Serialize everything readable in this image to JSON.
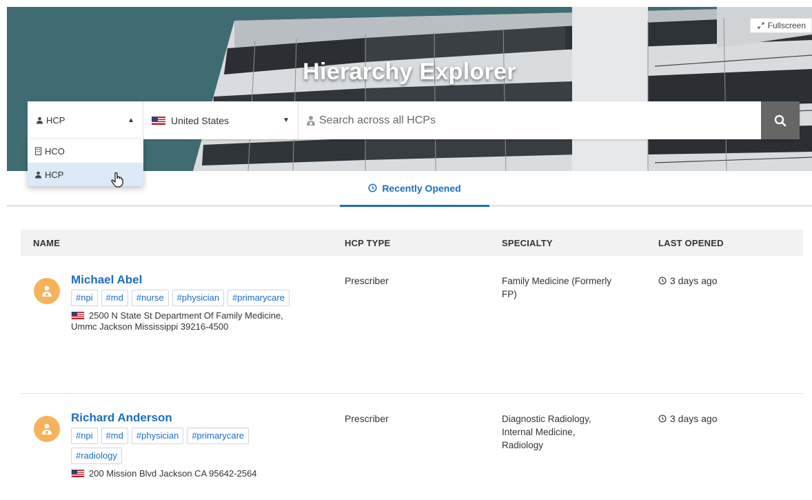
{
  "header": {
    "title": "Hierarchy Explorer",
    "fullscreen_label": "Fullscreen"
  },
  "search": {
    "type_value": "HCP",
    "country_value": "United States",
    "placeholder": "Search across all HCPs"
  },
  "type_dropdown": {
    "options": [
      {
        "label": "HCO",
        "icon": "building-icon"
      },
      {
        "label": "HCP",
        "icon": "person-icon",
        "highlighted": true
      }
    ]
  },
  "tabs": [
    {
      "label": "Recently Opened",
      "icon": "clock-icon",
      "active": true
    }
  ],
  "table": {
    "columns": [
      "NAME",
      "HCP TYPE",
      "SPECIALTY",
      "LAST OPENED"
    ],
    "rows": [
      {
        "name": "Michael Abel",
        "tags": [
          "#npi",
          "#md",
          "#nurse",
          "#physician",
          "#primarycare"
        ],
        "address": "2500 N State St Department Of Family Medicine, Ummc Jackson Mississippi 39216-4500",
        "hcp_type": "Prescriber",
        "specialty": "Family Medicine (Formerly FP)",
        "last_opened": "3 days ago"
      },
      {
        "name": "Richard Anderson",
        "tags": [
          "#npi",
          "#md",
          "#physician",
          "#primarycare",
          "#radiology"
        ],
        "address": "200 Mission Blvd Jackson CA 95642-2564",
        "hcp_type": "Prescriber",
        "specialty": "Diagnostic Radiology, Internal Medicine, Radiology",
        "last_opened": "3 days ago"
      }
    ]
  },
  "colors": {
    "accent": "#1a6dc5",
    "avatar": "#f6b35a",
    "hero_teal": "#3c6a70"
  }
}
